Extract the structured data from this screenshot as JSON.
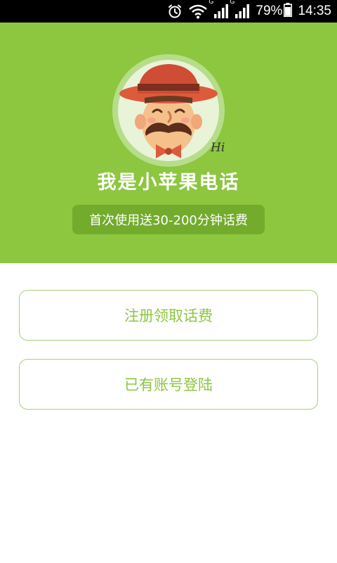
{
  "status_bar": {
    "battery_percent": "79%",
    "time": "14:35",
    "network_type": "G",
    "icons": [
      "alarm-icon",
      "wifi-icon",
      "signal-icon",
      "battery-icon"
    ]
  },
  "hero": {
    "title": "我是小苹果电话",
    "promo": "首次使用送30-200分钟话费",
    "mascot_greeting": "Hi",
    "background_color": "#8dc63f"
  },
  "actions": {
    "register_label": "注册领取话费",
    "login_label": "已有账号登陆",
    "accent_color": "#8dc63f"
  }
}
